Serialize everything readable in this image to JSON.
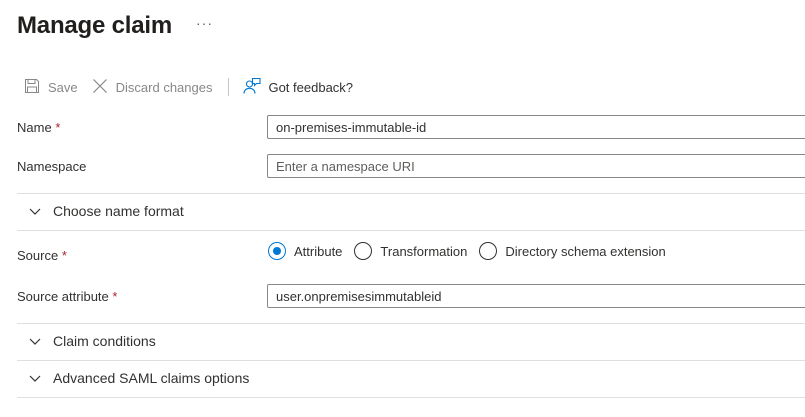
{
  "page": {
    "title": "Manage claim",
    "more_label": "···"
  },
  "toolbar": {
    "save_label": "Save",
    "discard_label": "Discard changes",
    "feedback_label": "Got feedback?"
  },
  "form": {
    "name": {
      "label": "Name",
      "required_mark": "*",
      "value": "on-premises-immutable-id"
    },
    "namespace": {
      "label": "Namespace",
      "placeholder": "Enter a namespace URI",
      "value": ""
    },
    "name_format": {
      "label": "Choose name format",
      "expanded": false
    },
    "source": {
      "label": "Source",
      "required_mark": "*",
      "options": [
        "Attribute",
        "Transformation",
        "Directory schema extension"
      ],
      "selected": "Attribute"
    },
    "source_attribute": {
      "label": "Source attribute",
      "required_mark": "*",
      "value": "user.onpremisesimmutableid"
    },
    "claim_conditions": {
      "label": "Claim conditions",
      "expanded": false
    },
    "advanced_saml": {
      "label": "Advanced SAML claims options",
      "expanded": false
    }
  },
  "colors": {
    "accent": "#0078d4",
    "required": "#a4262c",
    "disabled_text": "#8a8886"
  }
}
